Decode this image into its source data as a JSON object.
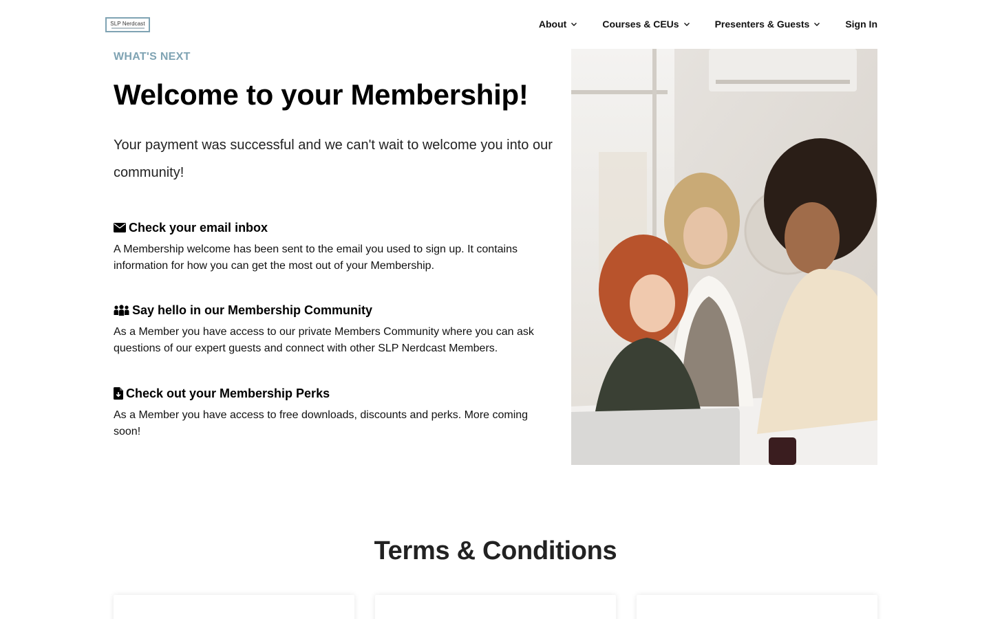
{
  "header": {
    "logo_text": "SLP Nerdcast",
    "nav": [
      {
        "label": "About",
        "has_dropdown": true
      },
      {
        "label": "Courses & CEUs",
        "has_dropdown": true
      },
      {
        "label": "Presenters & Guests",
        "has_dropdown": true
      },
      {
        "label": "Sign In",
        "has_dropdown": false
      }
    ]
  },
  "main": {
    "eyebrow": "WHAT'S NEXT",
    "title": "Welcome to your Membership!",
    "lead": "Your payment was successful and we can't wait to welcome you into our community!",
    "features": [
      {
        "icon": "envelope-icon",
        "title": "Check your email inbox",
        "body": "A Membership welcome has been sent to the email you used to sign up. It contains information for how you can get the most out of your Membership."
      },
      {
        "icon": "users-icon",
        "title": "Say hello in our Membership Community",
        "body": "As a Member you have access to our private Members Community where you can ask questions of our expert guests and connect with other SLP Nerdcast Members."
      },
      {
        "icon": "file-download-icon",
        "title": "Check out your Membership Perks",
        "body": "As a Member you have access to free downloads, discounts and perks. More coming soon!"
      }
    ],
    "photo_alt": "three-women-at-laptop-photo"
  },
  "terms": {
    "title": "Terms & Conditions"
  },
  "colors": {
    "accent": "#7fa3b3",
    "text": "#111111",
    "background": "#ffffff"
  }
}
